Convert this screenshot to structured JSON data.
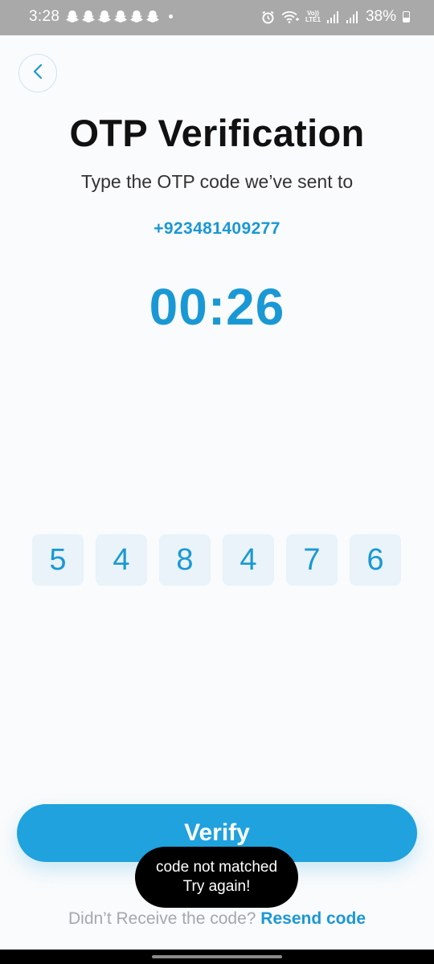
{
  "status_bar": {
    "time": "3:28",
    "notification_icons": [
      "snapchat-icon",
      "snapchat-icon",
      "snapchat-icon",
      "snapchat-icon",
      "snapchat-icon",
      "snapchat-icon"
    ],
    "battery": "38%",
    "network_label_top": "Vo))",
    "network_label_bottom": "LTE1"
  },
  "header": {
    "back_icon": "chevron-left-icon",
    "title": "OTP Verification",
    "subtitle": "Type the OTP code we’ve sent to",
    "phone": "+923481409277"
  },
  "timer": "00:26",
  "otp_digits": [
    "5",
    "4",
    "8",
    "4",
    "7",
    "6"
  ],
  "verify_label": "Verify",
  "toast": {
    "line1": "code not matched",
    "line2": "Try again!"
  },
  "resend": {
    "prompt": "Didn’t Receive the code?",
    "link": "Resend code"
  },
  "colors": {
    "accent": "#1a98d5",
    "button": "#1fa2de",
    "otp_box": "#e9f3f9",
    "status_bar": "#a9a9a9"
  }
}
